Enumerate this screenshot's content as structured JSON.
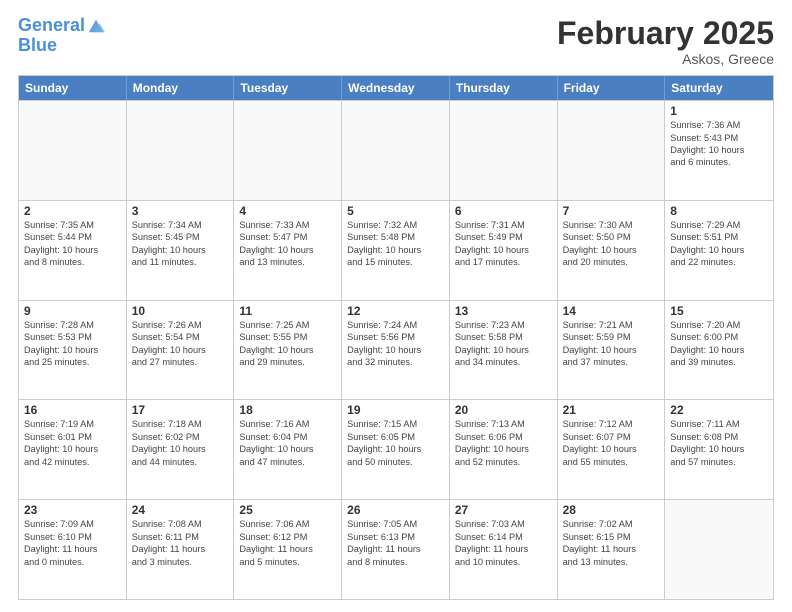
{
  "header": {
    "logo_line1": "General",
    "logo_line2": "Blue",
    "title": "February 2025",
    "subtitle": "Askos, Greece"
  },
  "days_of_week": [
    "Sunday",
    "Monday",
    "Tuesday",
    "Wednesday",
    "Thursday",
    "Friday",
    "Saturday"
  ],
  "weeks": [
    [
      {
        "day": "",
        "info": ""
      },
      {
        "day": "",
        "info": ""
      },
      {
        "day": "",
        "info": ""
      },
      {
        "day": "",
        "info": ""
      },
      {
        "day": "",
        "info": ""
      },
      {
        "day": "",
        "info": ""
      },
      {
        "day": "1",
        "info": "Sunrise: 7:36 AM\nSunset: 5:43 PM\nDaylight: 10 hours\nand 6 minutes."
      }
    ],
    [
      {
        "day": "2",
        "info": "Sunrise: 7:35 AM\nSunset: 5:44 PM\nDaylight: 10 hours\nand 8 minutes."
      },
      {
        "day": "3",
        "info": "Sunrise: 7:34 AM\nSunset: 5:45 PM\nDaylight: 10 hours\nand 11 minutes."
      },
      {
        "day": "4",
        "info": "Sunrise: 7:33 AM\nSunset: 5:47 PM\nDaylight: 10 hours\nand 13 minutes."
      },
      {
        "day": "5",
        "info": "Sunrise: 7:32 AM\nSunset: 5:48 PM\nDaylight: 10 hours\nand 15 minutes."
      },
      {
        "day": "6",
        "info": "Sunrise: 7:31 AM\nSunset: 5:49 PM\nDaylight: 10 hours\nand 17 minutes."
      },
      {
        "day": "7",
        "info": "Sunrise: 7:30 AM\nSunset: 5:50 PM\nDaylight: 10 hours\nand 20 minutes."
      },
      {
        "day": "8",
        "info": "Sunrise: 7:29 AM\nSunset: 5:51 PM\nDaylight: 10 hours\nand 22 minutes."
      }
    ],
    [
      {
        "day": "9",
        "info": "Sunrise: 7:28 AM\nSunset: 5:53 PM\nDaylight: 10 hours\nand 25 minutes."
      },
      {
        "day": "10",
        "info": "Sunrise: 7:26 AM\nSunset: 5:54 PM\nDaylight: 10 hours\nand 27 minutes."
      },
      {
        "day": "11",
        "info": "Sunrise: 7:25 AM\nSunset: 5:55 PM\nDaylight: 10 hours\nand 29 minutes."
      },
      {
        "day": "12",
        "info": "Sunrise: 7:24 AM\nSunset: 5:56 PM\nDaylight: 10 hours\nand 32 minutes."
      },
      {
        "day": "13",
        "info": "Sunrise: 7:23 AM\nSunset: 5:58 PM\nDaylight: 10 hours\nand 34 minutes."
      },
      {
        "day": "14",
        "info": "Sunrise: 7:21 AM\nSunset: 5:59 PM\nDaylight: 10 hours\nand 37 minutes."
      },
      {
        "day": "15",
        "info": "Sunrise: 7:20 AM\nSunset: 6:00 PM\nDaylight: 10 hours\nand 39 minutes."
      }
    ],
    [
      {
        "day": "16",
        "info": "Sunrise: 7:19 AM\nSunset: 6:01 PM\nDaylight: 10 hours\nand 42 minutes."
      },
      {
        "day": "17",
        "info": "Sunrise: 7:18 AM\nSunset: 6:02 PM\nDaylight: 10 hours\nand 44 minutes."
      },
      {
        "day": "18",
        "info": "Sunrise: 7:16 AM\nSunset: 6:04 PM\nDaylight: 10 hours\nand 47 minutes."
      },
      {
        "day": "19",
        "info": "Sunrise: 7:15 AM\nSunset: 6:05 PM\nDaylight: 10 hours\nand 50 minutes."
      },
      {
        "day": "20",
        "info": "Sunrise: 7:13 AM\nSunset: 6:06 PM\nDaylight: 10 hours\nand 52 minutes."
      },
      {
        "day": "21",
        "info": "Sunrise: 7:12 AM\nSunset: 6:07 PM\nDaylight: 10 hours\nand 55 minutes."
      },
      {
        "day": "22",
        "info": "Sunrise: 7:11 AM\nSunset: 6:08 PM\nDaylight: 10 hours\nand 57 minutes."
      }
    ],
    [
      {
        "day": "23",
        "info": "Sunrise: 7:09 AM\nSunset: 6:10 PM\nDaylight: 11 hours\nand 0 minutes."
      },
      {
        "day": "24",
        "info": "Sunrise: 7:08 AM\nSunset: 6:11 PM\nDaylight: 11 hours\nand 3 minutes."
      },
      {
        "day": "25",
        "info": "Sunrise: 7:06 AM\nSunset: 6:12 PM\nDaylight: 11 hours\nand 5 minutes."
      },
      {
        "day": "26",
        "info": "Sunrise: 7:05 AM\nSunset: 6:13 PM\nDaylight: 11 hours\nand 8 minutes."
      },
      {
        "day": "27",
        "info": "Sunrise: 7:03 AM\nSunset: 6:14 PM\nDaylight: 11 hours\nand 10 minutes."
      },
      {
        "day": "28",
        "info": "Sunrise: 7:02 AM\nSunset: 6:15 PM\nDaylight: 11 hours\nand 13 minutes."
      },
      {
        "day": "",
        "info": ""
      }
    ]
  ]
}
